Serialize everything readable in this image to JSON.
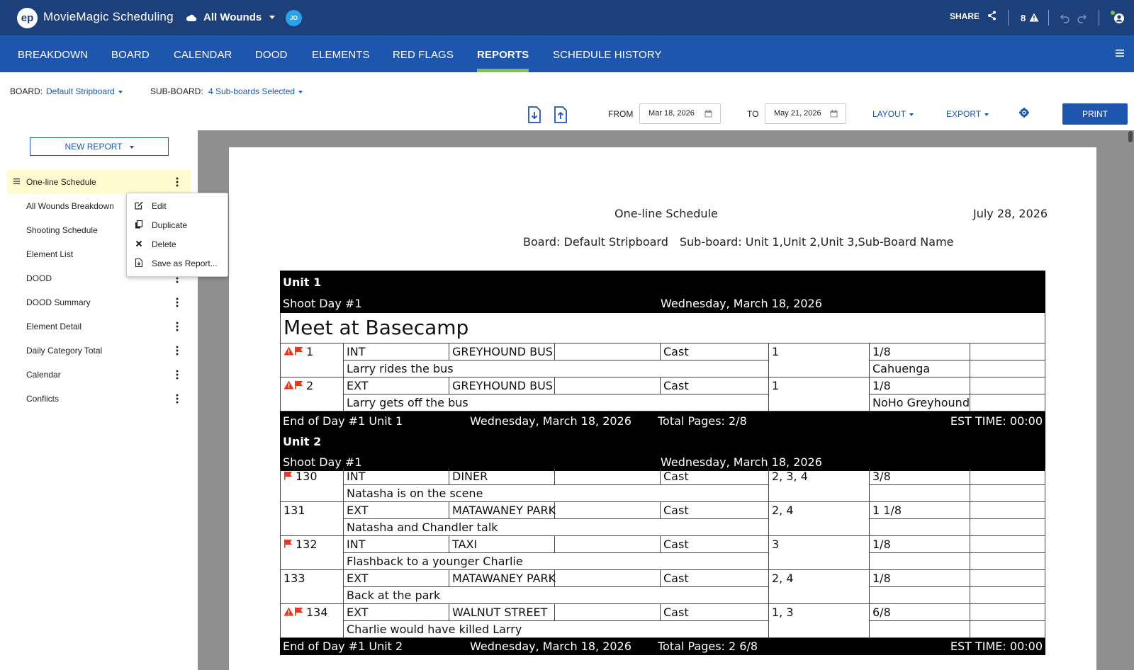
{
  "app": {
    "logo_text": "ep",
    "title": "MovieMagic Scheduling",
    "project": "All Wounds",
    "user_initials": "JO",
    "share_label": "SHARE",
    "flag_count": "8"
  },
  "nav": {
    "tabs": [
      "BREAKDOWN",
      "BOARD",
      "CALENDAR",
      "DOOD",
      "ELEMENTS",
      "RED FLAGS",
      "REPORTS",
      "SCHEDULE HISTORY"
    ],
    "active_tab": "REPORTS"
  },
  "toolbar": {
    "board_label": "BOARD:",
    "board_value": "Default Stripboard",
    "subboard_label": "SUB-BOARD:",
    "subboard_value": "4 Sub-boards Selected",
    "from_label": "FROM",
    "from_date": "Mar 18, 2026",
    "to_label": "TO",
    "to_date": "May 21, 2026",
    "layout_label": "LAYOUT",
    "export_label": "EXPORT",
    "print_label": "PRINT"
  },
  "sidebar": {
    "new_report_label": "NEW REPORT",
    "reports": [
      "One-line Schedule",
      "All Wounds Breakdown",
      "Shooting Schedule",
      "Element List",
      "DOOD",
      "DOOD Summary",
      "Element Detail",
      "Daily Category Total",
      "Calendar",
      "Conflicts"
    ],
    "selected": "One-line Schedule"
  },
  "context_menu": {
    "items": [
      {
        "label": "Edit",
        "icon": "edit-icon"
      },
      {
        "label": "Duplicate",
        "icon": "duplicate-icon"
      },
      {
        "label": "Delete",
        "icon": "delete-icon"
      },
      {
        "label": "Save as Report...",
        "icon": "save-report-icon"
      }
    ]
  },
  "report": {
    "title": "One-line Schedule",
    "date": "July 28, 2026",
    "board_info": "Board: Default Stripboard",
    "subboard_info": "Sub-board: Unit 1,Unit 2,Unit 3,Sub-Board Name",
    "unit1": {
      "name": "Unit 1",
      "shoot_day": "Shoot Day #1",
      "day_date": "Wednesday, March 18, 2026",
      "banner": "Meet at Basecamp",
      "scenes": [
        {
          "num": "1",
          "warn": true,
          "flag": true,
          "ie": "INT",
          "set": "GREYHOUND BUS",
          "cat": "Cast",
          "cast": "1",
          "pages": "1/8",
          "desc": "Larry rides the bus",
          "location": "Cahuenga"
        },
        {
          "num": "2",
          "warn": true,
          "flag": true,
          "ie": "EXT",
          "set": "GREYHOUND BUS",
          "cat": "Cast",
          "cast": "1",
          "pages": "1/8",
          "desc": "Larry gets off the bus",
          "location": "NoHo Greyhound"
        }
      ],
      "end": {
        "label": "End of Day #1 Unit 1",
        "date": "Wednesday, March 18, 2026",
        "pages": "Total Pages: 2/8",
        "est": "EST TIME: 00:00"
      }
    },
    "unit2": {
      "name": "Unit 2",
      "shoot_day": "Shoot Day #1",
      "day_date": "Wednesday, March 18, 2026",
      "scenes": [
        {
          "num": "130",
          "warn": false,
          "flag": true,
          "ie": "INT",
          "set": "DINER",
          "cat": "Cast",
          "cast": "2, 3, 4",
          "pages": "3/8",
          "desc": "Natasha is on the scene",
          "location": ""
        },
        {
          "num": "131",
          "warn": false,
          "flag": false,
          "ie": "EXT",
          "set": "MATAWANEY PARK",
          "cat": "Cast",
          "cast": "2, 4",
          "pages": "1 1/8",
          "desc": "Natasha and Chandler talk",
          "location": ""
        },
        {
          "num": "132",
          "warn": false,
          "flag": true,
          "ie": "INT",
          "set": "TAXI",
          "cat": "Cast",
          "cast": "3",
          "pages": "1/8",
          "desc": "Flashback to a younger Charlie",
          "location": ""
        },
        {
          "num": "133",
          "warn": false,
          "flag": false,
          "ie": "EXT",
          "set": "MATAWANEY PARK",
          "cat": "Cast",
          "cast": "2, 4",
          "pages": "1/8",
          "desc": "Back at the park",
          "location": ""
        },
        {
          "num": "134",
          "warn": true,
          "flag": true,
          "ie": "EXT",
          "set": "WALNUT STREET",
          "cat": "Cast",
          "cast": "1, 3",
          "pages": "6/8",
          "desc": "Charlie would have killed Larry",
          "location": ""
        }
      ],
      "end": {
        "label": "End of Day #1 Unit 2",
        "date": "Wednesday, March 18, 2026",
        "pages": "Total Pages: 2 6/8",
        "est": "EST TIME: 00:00"
      }
    }
  },
  "colors": {
    "topbar": "#1d3f7a",
    "navbar": "#1e56ad",
    "active_underline": "#7fc24b",
    "warning": "#e03a1e",
    "selected_row": "#fdfbcf"
  }
}
